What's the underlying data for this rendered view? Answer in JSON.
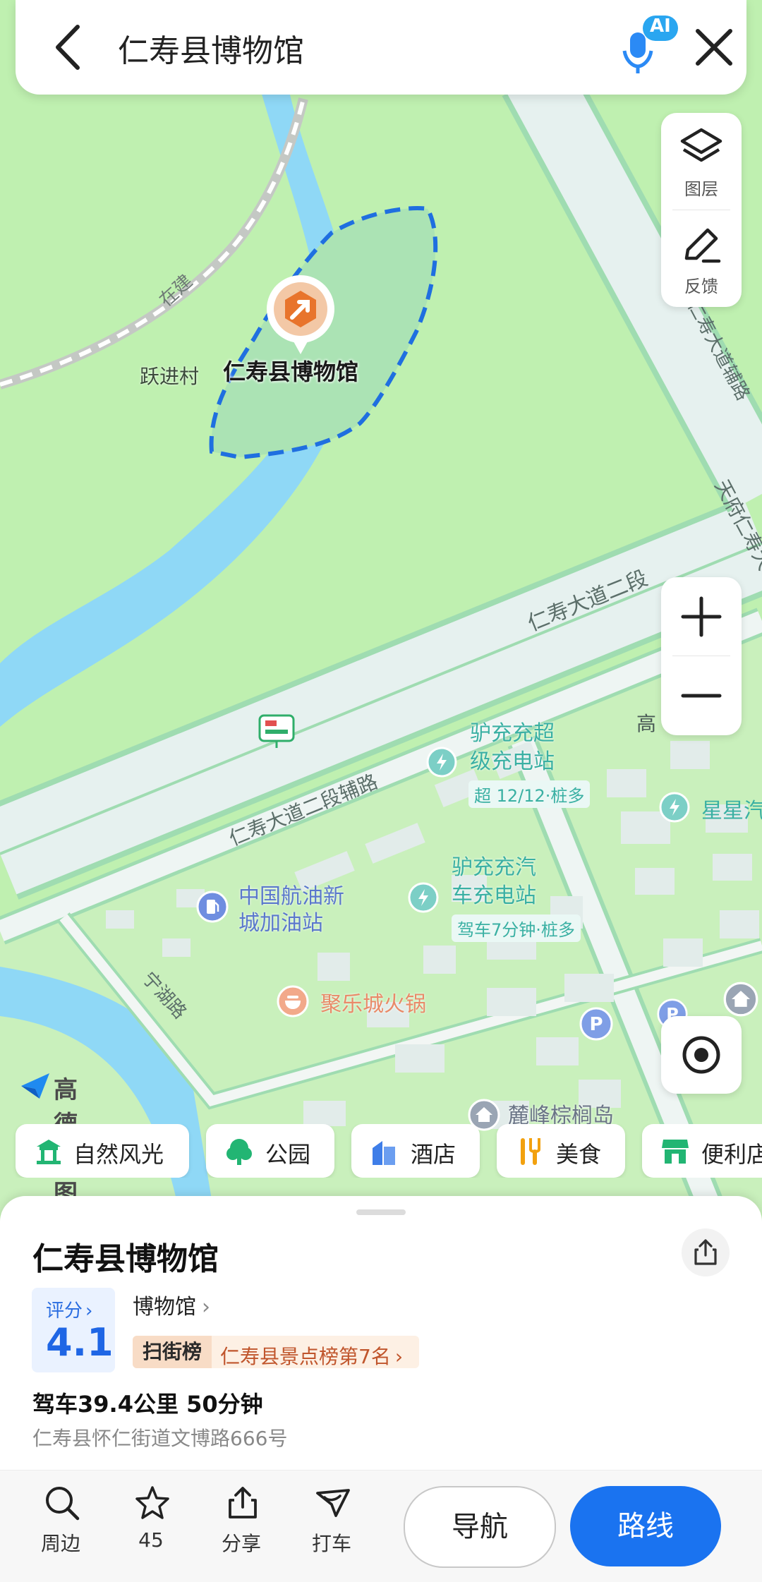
{
  "search": {
    "query": "仁寿县博物馆",
    "ai_badge": "AI"
  },
  "map_controls": {
    "layers_label": "图层",
    "feedback_label": "反馈"
  },
  "map_labels": {
    "museum": "仁寿县博物馆",
    "village": "跃进村",
    "rail": "在建",
    "road_main": "仁寿大道二段",
    "road_aux": "仁寿大道二段辅路",
    "road_aux_right": "仁寿大道辅路",
    "road_tianfu": "天府仁寿大",
    "road_ning": "宁湖路",
    "charger1_line1": "驴充充超",
    "charger1_line2": "级充电站",
    "charger1_info": "超 12/12·桩多",
    "charger2_line1": "驴充充汽",
    "charger2_line2": "车充电站",
    "charger2_info": "驾车7分钟·桩多",
    "gas_line1": "中国航油新",
    "gas_line2": "城加油站",
    "hotpot": "聚乐城火锅",
    "residential": "麓峰棕榈岛",
    "edge_star": "星星汽",
    "edge_gao": "高"
  },
  "logo_text": "高德地图",
  "chips": [
    "自然风光",
    "公园",
    "酒店",
    "美食",
    "便利店"
  ],
  "poi": {
    "title": "仁寿县博物馆",
    "rating_label": "评分",
    "rating_value": "4.1",
    "category": "博物馆",
    "rank_badge": "扫街榜",
    "rank_text": "仁寿县景点榜第7名",
    "drive_info": "驾车39.4公里 50分钟",
    "address": "仁寿县怀仁街道文博路666号"
  },
  "actions": {
    "nearby": "周边",
    "favorites": "45",
    "share": "分享",
    "taxi": "打车",
    "navigate": "导航",
    "route": "路线"
  },
  "colors": {
    "map_green": "#bff0b0",
    "river": "#8fd8f6",
    "road": "#e4f0ee",
    "accent_blue": "#1a73f0",
    "museum_orange": "#e8742c"
  }
}
